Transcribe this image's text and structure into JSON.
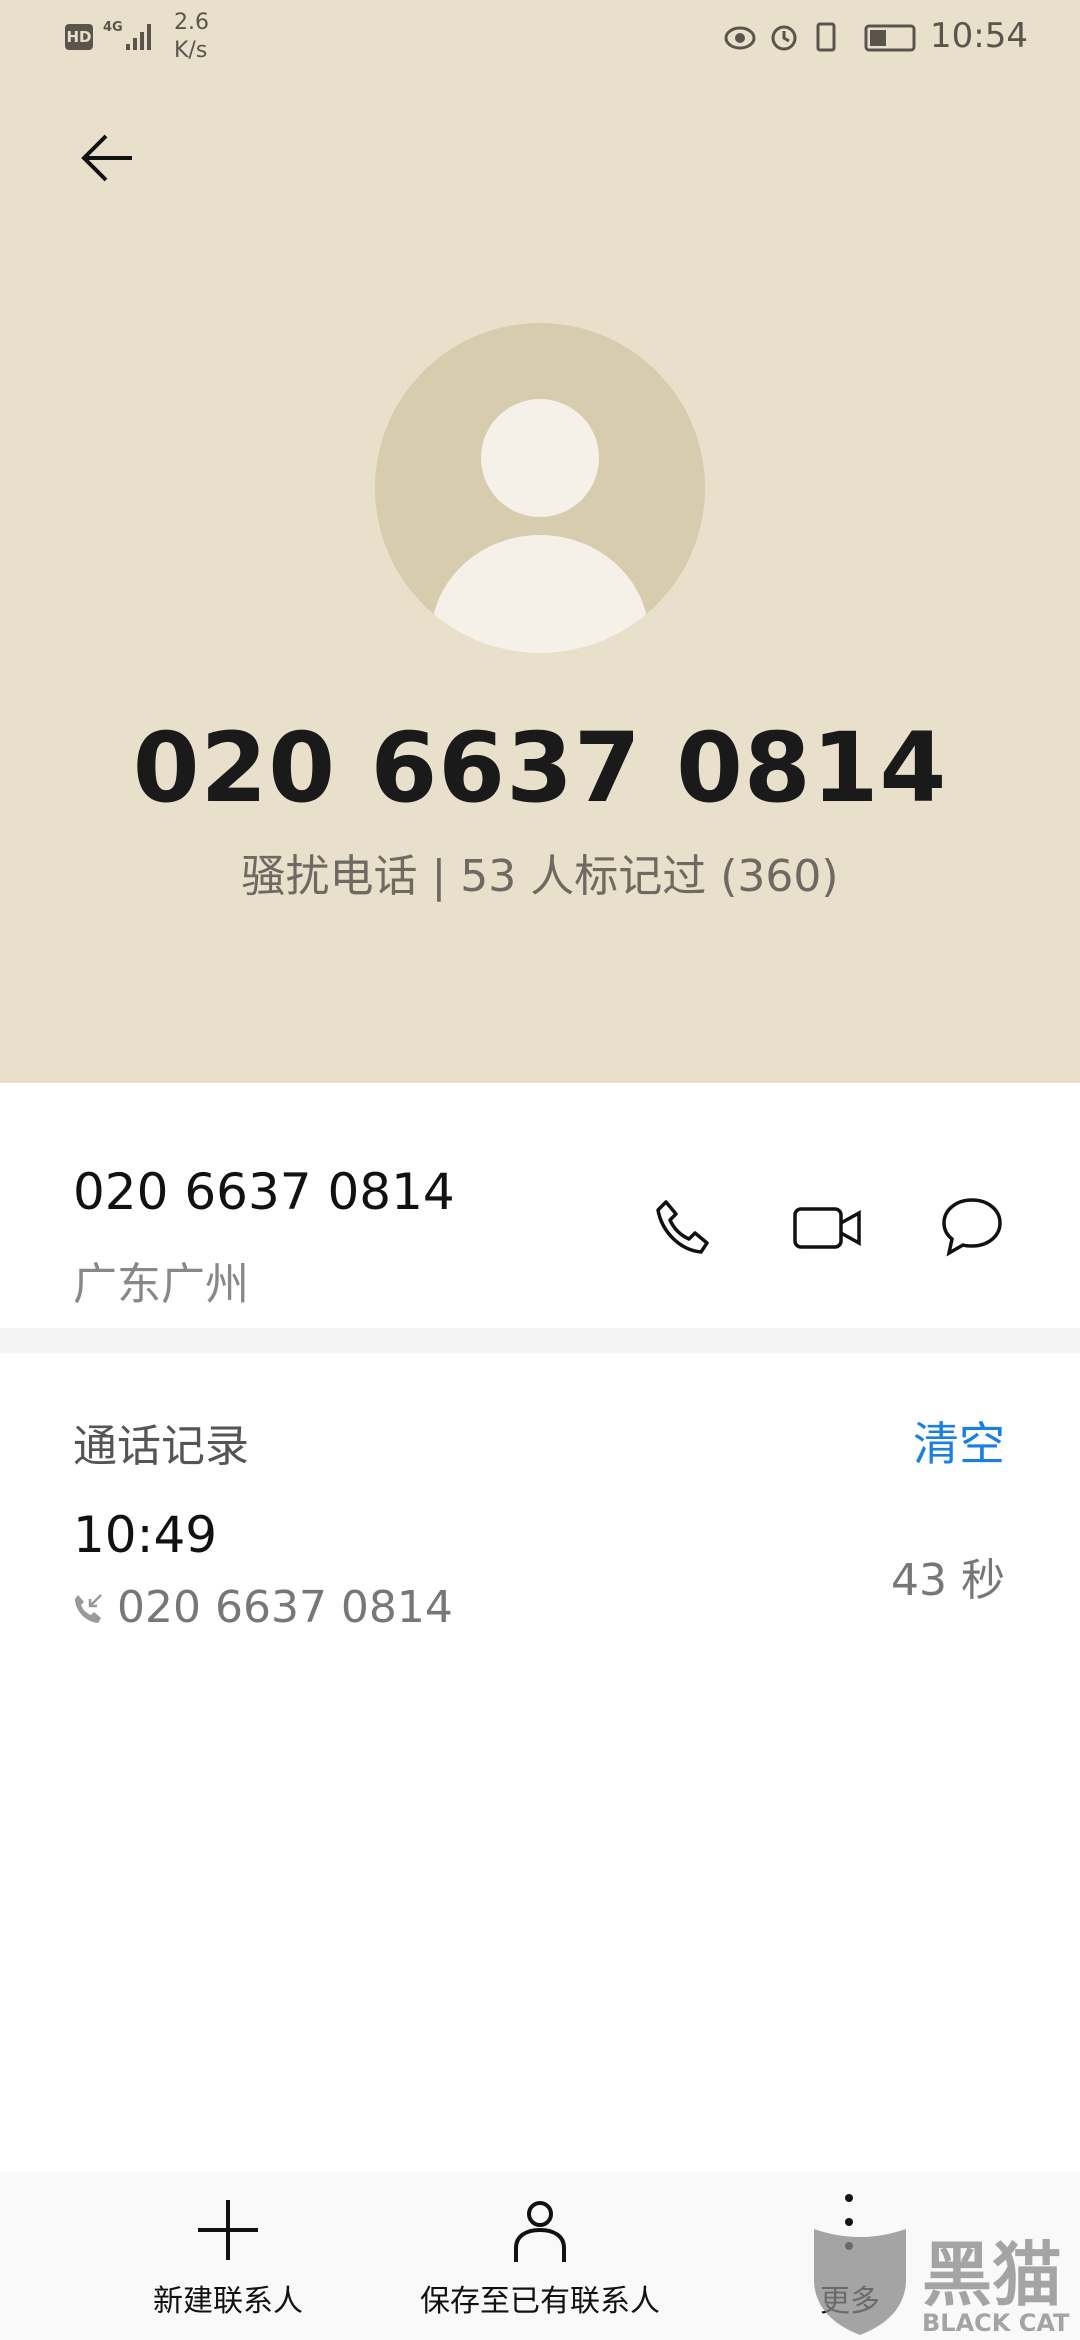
{
  "status_bar": {
    "hd": "HD",
    "network": "4G",
    "speed": "2.6",
    "speed_unit": "K/s",
    "time": "10:54",
    "icons": [
      "eye-icon",
      "alarm-icon",
      "vibrate-icon",
      "battery-icon"
    ]
  },
  "header": {
    "number": "020 6637 0814",
    "tag": "骚扰电话 | 53 人标记过 (360)"
  },
  "contact": {
    "number": "020 6637 0814",
    "location": "广东广州",
    "actions": [
      "phone-icon",
      "video-call-icon",
      "message-icon"
    ]
  },
  "call_log": {
    "title": "通话记录",
    "clear_label": "清空",
    "entries": [
      {
        "time": "10:49",
        "number": "020 6637 0814",
        "duration": "43 秒"
      }
    ]
  },
  "bottom_bar": {
    "items": [
      {
        "label": "新建联系人",
        "icon": "plus-icon"
      },
      {
        "label": "保存至已有联系人",
        "icon": "person-icon"
      },
      {
        "label": "更多",
        "icon": "more-icon"
      }
    ]
  },
  "watermark": {
    "text": "黑猫",
    "subtext": "BLACK CAT"
  },
  "colors": {
    "header_bg": "#e9e0cb",
    "accent": "#1a7fe0"
  }
}
